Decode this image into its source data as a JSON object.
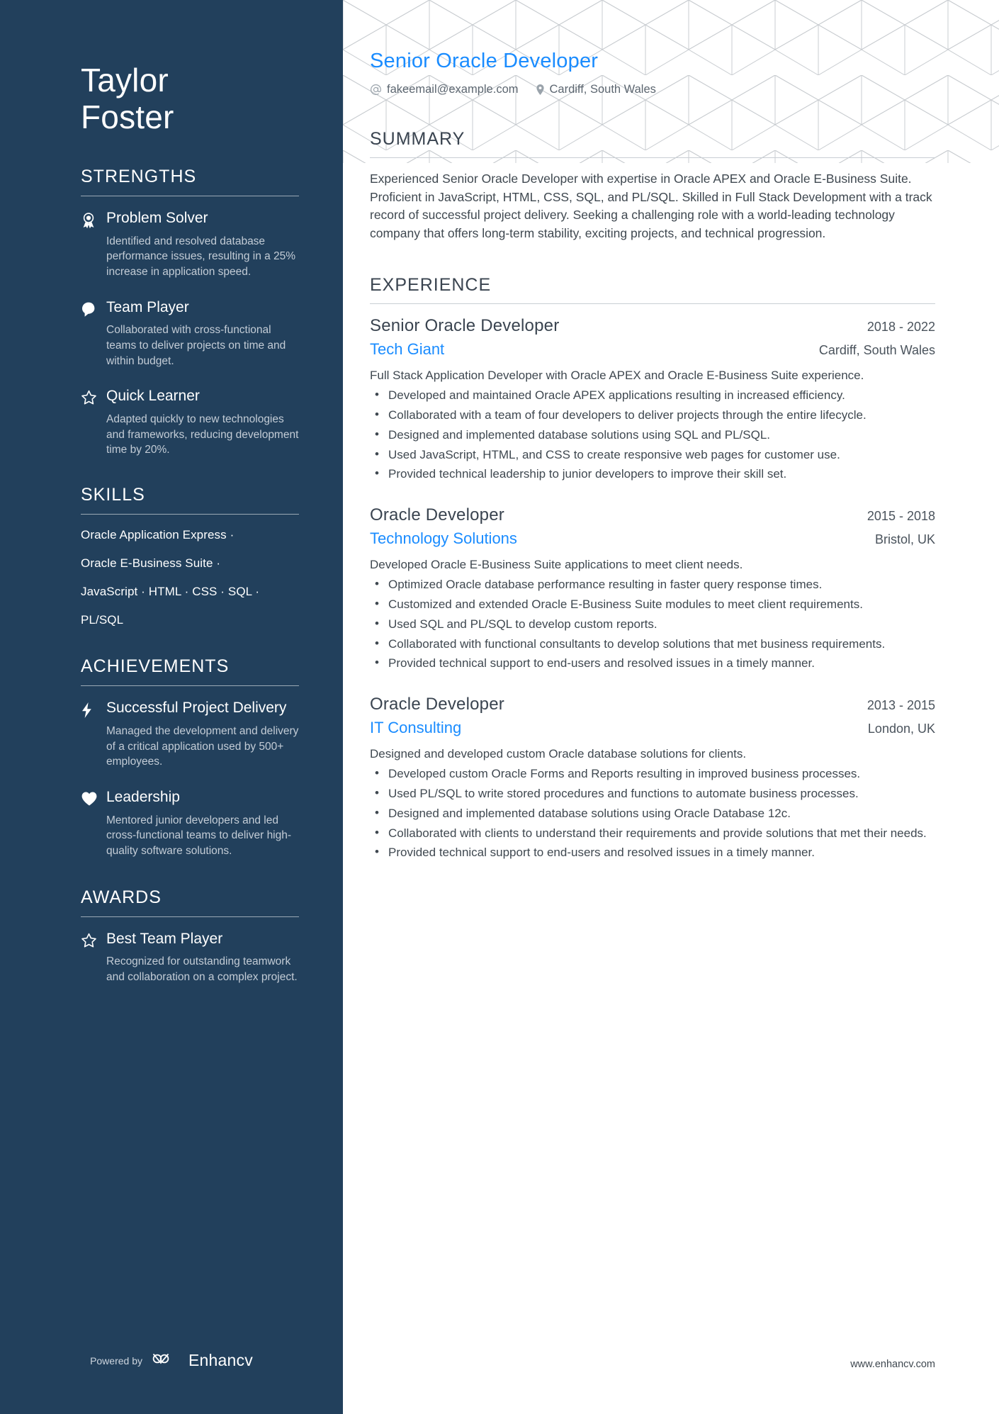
{
  "sidebar": {
    "name_first": "Taylor",
    "name_last": "Foster",
    "strengths": {
      "heading": "STRENGTHS",
      "items": [
        {
          "icon": "award-ribbon-icon",
          "title": "Problem Solver",
          "desc": "Identified and resolved database performance issues, resulting in a 25% increase in application speed."
        },
        {
          "icon": "head-profile-icon",
          "title": "Team Player",
          "desc": "Collaborated with cross-functional teams to deliver projects on time and within budget."
        },
        {
          "icon": "star-outline-icon",
          "title": "Quick Learner",
          "desc": "Adapted quickly to new technologies and frameworks, reducing development time by 20%."
        }
      ]
    },
    "skills": {
      "heading": "SKILLS",
      "lines": [
        "Oracle Application Express ·",
        "Oracle E-Business Suite ·",
        "JavaScript · HTML · CSS · SQL ·",
        "PL/SQL"
      ]
    },
    "achievements": {
      "heading": "ACHIEVEMENTS",
      "items": [
        {
          "icon": "lightning-bolt-icon",
          "title": "Successful Project Delivery",
          "desc": "Managed the development and delivery of a critical application used by 500+ employees."
        },
        {
          "icon": "heart-filled-icon",
          "title": "Leadership",
          "desc": "Mentored junior developers and led cross-functional teams to deliver high-quality software solutions."
        }
      ]
    },
    "awards": {
      "heading": "AWARDS",
      "items": [
        {
          "icon": "star-outline-icon",
          "title": "Best Team Player",
          "desc": "Recognized for outstanding teamwork and collaboration on a complex project."
        }
      ]
    },
    "footer": {
      "powered_by": "Powered by",
      "brand": "Enhancv"
    }
  },
  "main": {
    "headline": "Senior Oracle Developer",
    "contact": {
      "email_icon": "at-sign-icon",
      "email": "fakeemail@example.com",
      "location_icon": "map-pin-icon",
      "location": "Cardiff, South Wales"
    },
    "summary": {
      "heading": "SUMMARY",
      "text": "Experienced Senior Oracle Developer with expertise in Oracle APEX and Oracle E-Business Suite. Proficient in JavaScript, HTML, CSS, SQL, and PL/SQL. Skilled in Full Stack Development with a track record of successful project delivery. Seeking a challenging role with a world-leading technology company that offers long-term stability, exciting projects, and technical progression."
    },
    "experience": {
      "heading": "EXPERIENCE",
      "jobs": [
        {
          "position": "Senior Oracle Developer",
          "dates": "2018 - 2022",
          "company": "Tech Giant",
          "location": "Cardiff, South Wales",
          "summary": "Full Stack Application Developer with Oracle APEX and Oracle E-Business Suite experience.",
          "bullets": [
            "Developed and maintained Oracle APEX applications resulting in increased efficiency.",
            "Collaborated with a team of four developers to deliver projects through the entire lifecycle.",
            "Designed and implemented database solutions using SQL and PL/SQL.",
            "Used JavaScript, HTML, and CSS to create responsive web pages for customer use.",
            "Provided technical leadership to junior developers to improve their skill set."
          ]
        },
        {
          "position": "Oracle Developer",
          "dates": "2015 - 2018",
          "company": "Technology Solutions",
          "location": "Bristol, UK",
          "summary": "Developed Oracle E-Business Suite applications to meet client needs.",
          "bullets": [
            "Optimized Oracle database performance resulting in faster query response times.",
            "Customized and extended Oracle E-Business Suite modules to meet client requirements.",
            "Used SQL and PL/SQL to develop custom reports.",
            "Collaborated with functional consultants to develop solutions that met business requirements.",
            "Provided technical support to end-users and resolved issues in a timely manner."
          ]
        },
        {
          "position": "Oracle Developer",
          "dates": "2013 - 2015",
          "company": "IT Consulting",
          "location": "London, UK",
          "summary": "Designed and developed custom Oracle database solutions for clients.",
          "bullets": [
            "Developed custom Oracle Forms and Reports resulting in improved business processes.",
            "Used PL/SQL to write stored procedures and functions to automate business processes.",
            "Designed and implemented database solutions using Oracle Database 12c.",
            "Collaborated with clients to understand their requirements and provide solutions that met their needs.",
            "Provided technical support to end-users and resolved issues in a timely manner."
          ]
        }
      ]
    },
    "footer_url": "www.enhancv.com"
  },
  "colors": {
    "sidebar_bg": "#22405c",
    "accent_blue": "#1a8cff",
    "body_text": "#3f4850",
    "muted_text": "#c3ccd6"
  }
}
